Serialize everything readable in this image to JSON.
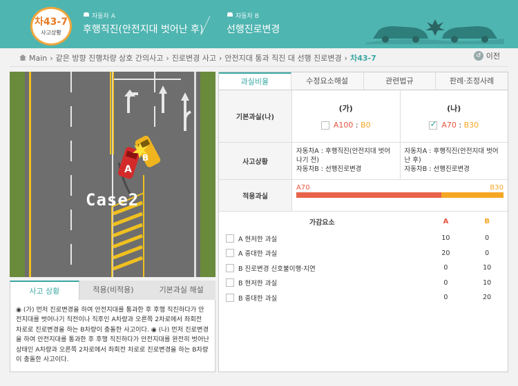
{
  "header": {
    "badge_code": "차43-7",
    "badge_sub": "사고상황",
    "car_a_label": "자동차 A",
    "car_a_title": "후행직진(안전지대 벗어난 후)",
    "car_b_label": "자동차 B",
    "car_b_title": "선행진로변경"
  },
  "breadcrumb": {
    "items": [
      "Main",
      "같은 방향 진행차량 상호 간의사고",
      "진로변경 사고",
      "안전지대 통과 직진 대 선행 진로변경"
    ],
    "current": "차43-7",
    "prev_label": "이전"
  },
  "scene": {
    "case_label": "Case2",
    "car_a": "A",
    "car_b": "B"
  },
  "left_tabs": [
    "사고 상황",
    "적용(비적용)",
    "기본과실 해설"
  ],
  "left_body": "◉ (가) 먼저 진로변경을 하여 안전지대를 통과한 후 후행 직진하다가 안전지대를 벗어나기 직전이나 직후인 A차량과 오른쪽 2차로에서 좌회전 차로로 진로변경을 하는 B차량이 충돌한 사고이다. ◉ (나) 먼저 진로변경을 하여 안전지대를 통과한 후 후행 직진하다가 안전지대를 완전히 벗어난 상태인 A차량과 오른쪽 2차로에서 좌회전 차로로 진로변경을 하는 B차량이 충돌한 사고이다.",
  "tabs": [
    "과실비율",
    "수정요소해설",
    "관련법규",
    "판례·조정사례"
  ],
  "basic": {
    "label": "기본과실(나)",
    "ga_title": "(가)",
    "ga_a": "A100",
    "ga_b": "B0",
    "na_title": "(나)",
    "na_a": "A70",
    "na_b": "B30",
    "sep": " : "
  },
  "situation": {
    "label": "사고상황",
    "ga_line1": "자동차A : 후행직진(안전지대 벗어나기 전)",
    "ga_line2": "자동차B : 선행진로변경",
    "na_line1": "자동차A : 후행직진(안전지대 벗어난 후)",
    "na_line2": "자동차B : 선행진로변경"
  },
  "applied": {
    "label": "적용과실",
    "a": "A70",
    "b": "B30",
    "a_share": 70
  },
  "factors": {
    "header_name": "가감요소",
    "header_a": "A",
    "header_b": "B",
    "rows": [
      {
        "name": "A 현저한 과실",
        "a": "10",
        "b": "0"
      },
      {
        "name": "A 중대한 과실",
        "a": "20",
        "b": "0"
      },
      {
        "name": "B 진로변경 신호불이행·지연",
        "a": "0",
        "b": "10"
      },
      {
        "name": "B 현저한 과실",
        "a": "0",
        "b": "10"
      },
      {
        "name": "B 중대한 과실",
        "a": "0",
        "b": "20"
      }
    ]
  },
  "colors": {
    "teal": "#4fb5b1",
    "a_red": "#e8533e",
    "b_orange": "#f5a623"
  }
}
